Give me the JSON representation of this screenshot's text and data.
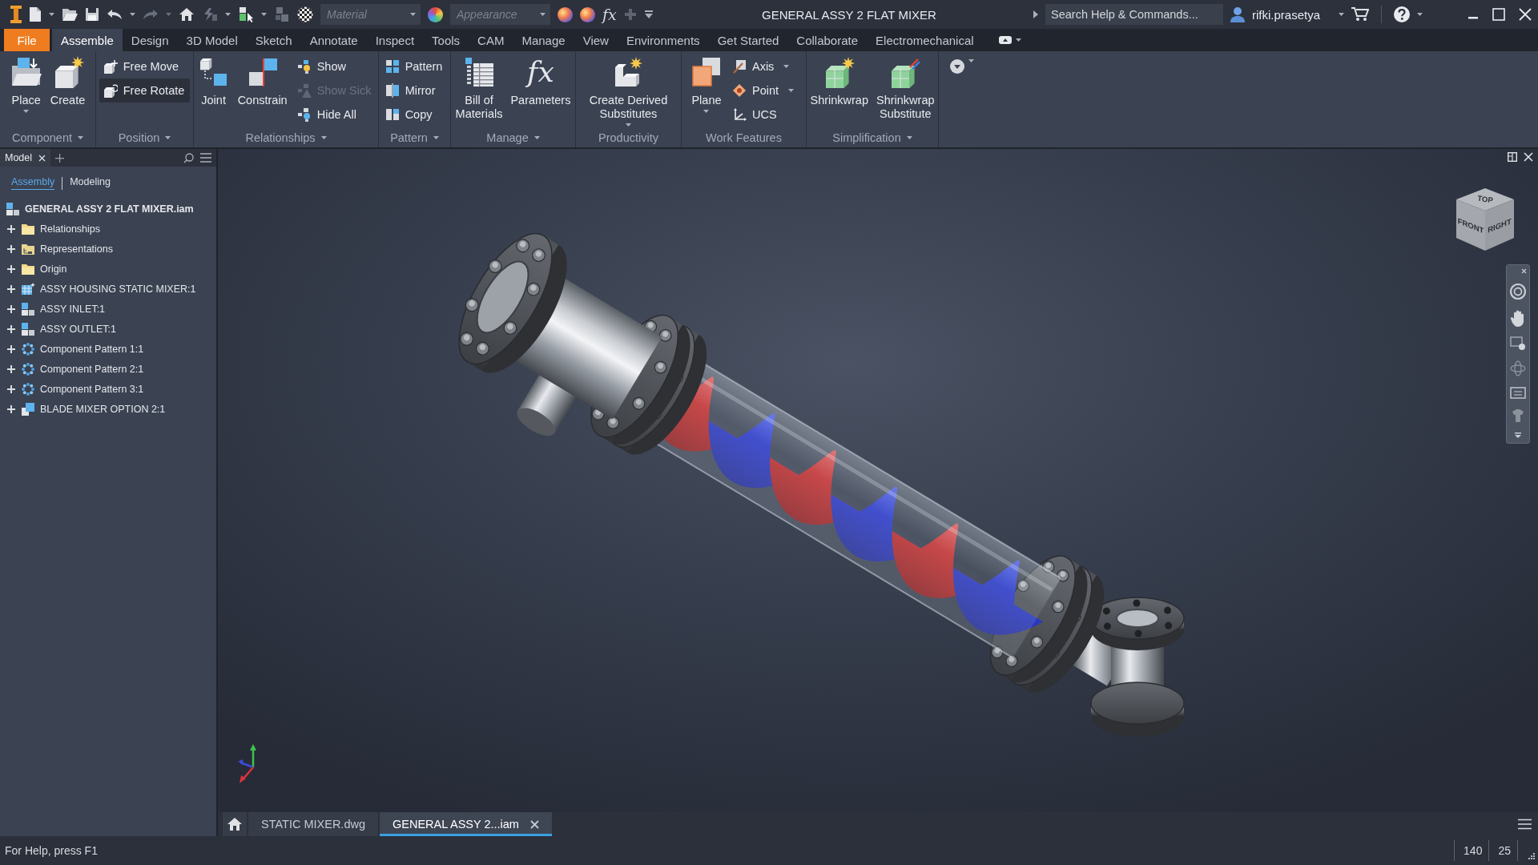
{
  "title_bar": {
    "material": {
      "placeholder": "Material"
    },
    "appearance": {
      "placeholder": "Appearance"
    },
    "parameters_glyph": "fx",
    "title": "GENERAL ASSY 2 FLAT MIXER",
    "search": {
      "placeholder": "Search Help & Commands..."
    },
    "user": "rifki.prasetya"
  },
  "ribbon_tabs": [
    {
      "label": "File",
      "kind": "application",
      "selected": false
    },
    {
      "label": "Assemble",
      "kind": "tab",
      "selected": true
    },
    {
      "label": "Design",
      "kind": "tab",
      "selected": false
    },
    {
      "label": "3D Model",
      "kind": "tab",
      "selected": false
    },
    {
      "label": "Sketch",
      "kind": "tab",
      "selected": false
    },
    {
      "label": "Annotate",
      "kind": "tab",
      "selected": false
    },
    {
      "label": "Inspect",
      "kind": "tab",
      "selected": false
    },
    {
      "label": "Tools",
      "kind": "tab",
      "selected": false
    },
    {
      "label": "CAM",
      "kind": "tab",
      "selected": false
    },
    {
      "label": "Manage",
      "kind": "tab",
      "selected": false
    },
    {
      "label": "View",
      "kind": "tab",
      "selected": false
    },
    {
      "label": "Environments",
      "kind": "tab",
      "selected": false
    },
    {
      "label": "Get Started",
      "kind": "tab",
      "selected": false
    },
    {
      "label": "Collaborate",
      "kind": "tab",
      "selected": false
    },
    {
      "label": "Electromechanical",
      "kind": "tab",
      "selected": false
    }
  ],
  "ribbon_panels": [
    {
      "label": "Component",
      "menu": true,
      "large_tools": [
        {
          "label": "Place",
          "menu": true
        },
        {
          "label": "Create",
          "menu": false
        }
      ]
    },
    {
      "label": "Position",
      "menu": true,
      "small_tools": [
        {
          "label": "Free Move",
          "menu": false,
          "active": false,
          "disabled": false
        },
        {
          "label": "Free Rotate",
          "menu": false,
          "active": true,
          "disabled": false
        }
      ]
    },
    {
      "label": "Relationships",
      "menu": true,
      "large_tools": [
        {
          "label": "Joint",
          "menu": false
        },
        {
          "label": "Constrain",
          "menu": false
        }
      ],
      "small_tools": [
        {
          "label": "Show",
          "menu": false,
          "active": false,
          "disabled": false
        },
        {
          "label": "Show Sick",
          "menu": false,
          "active": false,
          "disabled": true
        },
        {
          "label": "Hide All",
          "menu": false,
          "active": false,
          "disabled": false
        }
      ]
    },
    {
      "label": "Pattern",
      "menu": true,
      "small_tools": [
        {
          "label": "Pattern",
          "menu": false,
          "active": false,
          "disabled": false
        },
        {
          "label": "Mirror",
          "menu": false,
          "active": false,
          "disabled": false
        },
        {
          "label": "Copy",
          "menu": false,
          "active": false,
          "disabled": false
        }
      ]
    },
    {
      "label": "Manage",
      "menu": true,
      "large_tools": [
        {
          "label": "Bill of\nMaterials",
          "menu": false
        },
        {
          "label": "Parameters",
          "glyph": "fx",
          "menu": false
        }
      ]
    },
    {
      "label": "Productivity",
      "menu": false,
      "large_tools": [
        {
          "label": "Create Derived\nSubstitutes",
          "menu": true
        }
      ]
    },
    {
      "label": "Work Features",
      "menu": false,
      "large_tools": [
        {
          "label": "Plane",
          "menu": true
        }
      ],
      "small_tools": [
        {
          "label": "Axis",
          "menu": true,
          "active": false,
          "disabled": false
        },
        {
          "label": "Point",
          "menu": true,
          "active": false,
          "disabled": false
        },
        {
          "label": "UCS",
          "menu": false,
          "active": false,
          "disabled": false
        }
      ]
    },
    {
      "label": "Simplification",
      "menu": true,
      "large_tools": [
        {
          "label": "Shrinkwrap",
          "menu": false
        },
        {
          "label": "Shrinkwrap\nSubstitute",
          "menu": false
        }
      ]
    }
  ],
  "browser": {
    "tabs": [
      {
        "label": "Model",
        "selected": true
      }
    ],
    "views": [
      {
        "label": "Assembly",
        "selected": true
      },
      {
        "label": "Modeling",
        "selected": false
      }
    ],
    "tree": [
      {
        "label": "GENERAL ASSY 2 FLAT MIXER.iam",
        "kind": "assembly",
        "children": [
          {
            "label": "Relationships",
            "kind": "folder",
            "expanded": false
          },
          {
            "label": "Representations",
            "kind": "representations",
            "expanded": false
          },
          {
            "label": "Origin",
            "kind": "folder",
            "expanded": false
          },
          {
            "label": "ASSY HOUSING STATIC MIXER:1",
            "kind": "housing",
            "expanded": false
          },
          {
            "label": "ASSY INLET:1",
            "kind": "assembly",
            "expanded": false
          },
          {
            "label": "ASSY OUTLET:1",
            "kind": "assembly",
            "expanded": false
          },
          {
            "label": "Component Pattern 1:1",
            "kind": "pattern",
            "expanded": false
          },
          {
            "label": "Component Pattern 2:1",
            "kind": "pattern",
            "expanded": false
          },
          {
            "label": "Component Pattern 3:1",
            "kind": "pattern",
            "expanded": false
          },
          {
            "label": "BLADE MIXER OPTION 2:1",
            "kind": "part",
            "expanded": false
          }
        ]
      }
    ]
  },
  "view_cube": {
    "faces": [
      "TOP",
      "FRONT",
      "RIGHT"
    ]
  },
  "document_tabs": [
    {
      "label": "STATIC MIXER.dwg",
      "selected": false
    },
    {
      "label": "GENERAL ASSY 2...iam",
      "selected": true
    }
  ],
  "status_bar": {
    "help": "For Help, press F1",
    "counters": [
      "140",
      "25"
    ]
  }
}
